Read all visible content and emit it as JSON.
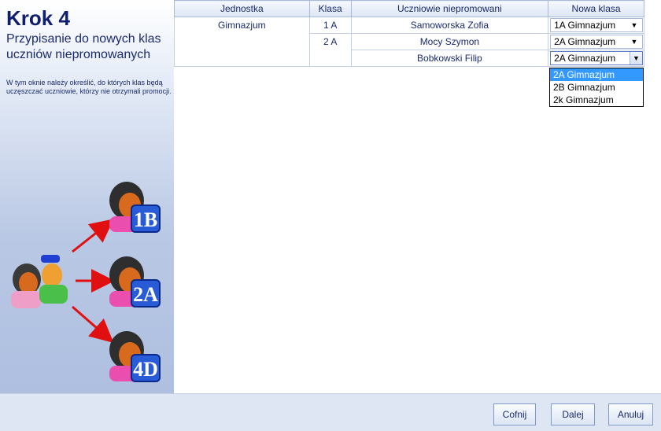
{
  "wizard": {
    "step_title": "Krok 4",
    "step_subtitle": "Przypisanie do nowych klas uczniów niepromowanych",
    "step_description": "W tym oknie należy określić, do których klas będą uczęszczać uczniowie, którzy nie otrzymali promocji."
  },
  "illustration": {
    "labels": [
      "1B",
      "2A",
      "4D"
    ]
  },
  "table": {
    "headers": [
      "Jednostka",
      "Klasa",
      "Uczniowie niepromowani",
      "Nowa klasa"
    ],
    "unit": "Gimnazjum",
    "classes": [
      "1 A",
      "2 A"
    ],
    "students": [
      {
        "name": "Samoworska Zofia",
        "new_class": "1A Gimnazjum"
      },
      {
        "name": "Mocy Szymon",
        "new_class": "2A Gimnazjum"
      },
      {
        "name": "Bobkowski Filip",
        "new_class": "2A Gimnazjum"
      }
    ]
  },
  "dropdown": {
    "options": [
      "2A Gimnazjum",
      "2B Gimnazjum",
      "2k Gimnazjum"
    ],
    "selected": "2A Gimnazjum"
  },
  "buttons": {
    "back": "Cofnij",
    "next": "Dalej",
    "cancel": "Anuluj"
  },
  "colors": {
    "accent": "#3399ff",
    "title": "#0f1f6e",
    "badge": "#2a5bd7"
  }
}
